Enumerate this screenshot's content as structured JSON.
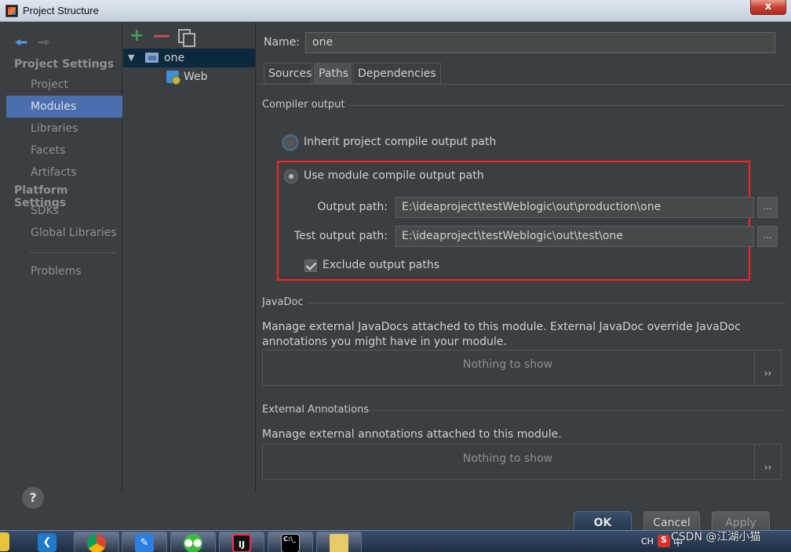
{
  "window": {
    "title": "Project Structure",
    "close_label": "x"
  },
  "nav": {
    "section_project": "Project Settings",
    "project_items": [
      "Project",
      "Modules",
      "Libraries",
      "Facets",
      "Artifacts"
    ],
    "section_platform": "Platform Settings",
    "platform_items": [
      "SDKs",
      "Global Libraries"
    ],
    "problems": "Problems",
    "active": "Modules",
    "help_label": "?"
  },
  "tree": {
    "module": "one",
    "child": "Web"
  },
  "main": {
    "name_label": "Name:",
    "name_value": "one",
    "tabs": [
      "Sources",
      "Paths",
      "Dependencies"
    ],
    "active_tab": "Paths",
    "compiler_output": {
      "title": "Compiler output",
      "inherit_label": "Inherit project compile output path",
      "use_module_label": "Use module compile output path",
      "output_path_label": "Output path:",
      "output_path_value": "E:\\ideaproject\\testWeblogic\\out\\production\\one",
      "test_output_label": "Test output path:",
      "test_output_value": "E:\\ideaproject\\testWeblogic\\out\\test\\one",
      "browse_label": "...",
      "exclude_label": "Exclude output paths",
      "exclude_checked": true
    },
    "javadoc": {
      "title": "JavaDoc",
      "description": "Manage external JavaDocs attached to this module. External JavaDoc override JavaDoc annotations you might have in your module.",
      "empty": "Nothing to show",
      "expand": "››"
    },
    "annotations": {
      "title": "External Annotations",
      "description": "Manage external annotations attached to this module.",
      "empty": "Nothing to show",
      "expand": "››"
    }
  },
  "buttons": {
    "ok": "OK",
    "cancel": "Cancel",
    "apply": "Apply"
  },
  "taskbar": {
    "apps": [
      "vscode-icon",
      "chrome-icon",
      "pen-icon",
      "wechat-icon",
      "intellij-icon",
      "terminal-icon",
      "folder-icon"
    ],
    "intellij_glyph": "IJ",
    "terminal_glyph": "C:\\_",
    "tray_lang": "CH",
    "tray_s": "S",
    "tray_zh": "中"
  },
  "watermark": "CSDN @江湖小猫"
}
